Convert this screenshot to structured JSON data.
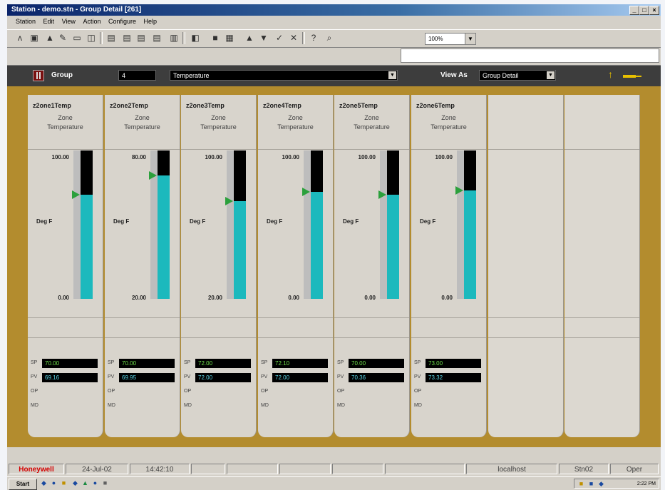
{
  "window": {
    "title": "Station - demo.stn - Group Detail [261]",
    "buttons": [
      "_",
      "□",
      "×"
    ]
  },
  "menu": [
    "Station",
    "Edit",
    "View",
    "Action",
    "Configure",
    "Help"
  ],
  "toolbar": {
    "icons": [
      "antenna-icon",
      "station-icon",
      "lock-icon",
      "pen-icon",
      "folder-icon",
      "display-icon",
      "page1-icon",
      "page2-icon",
      "page3-icon",
      "page4-icon",
      "print-icon",
      "chart-icon",
      "grid-icon",
      "trend-icon",
      "arrow-up-icon",
      "arrow-down-icon",
      "check-icon",
      "cancel-icon",
      "help-icon",
      "zoom-icon"
    ],
    "zoom": "100%"
  },
  "header": {
    "group_label": "Group",
    "group_number": "4",
    "group_name": "Temperature",
    "view_as_label": "View As",
    "view_as_value": "Group Detail"
  },
  "panels": [
    {
      "name": "z2one1Temp",
      "desc1": "Zone",
      "desc2": "Temperature",
      "max": "100.00",
      "min": "0.00",
      "units": "Deg F",
      "pv_fraction": 0.7,
      "sp_fraction": 0.7,
      "sp_label": "SP",
      "sp": "70.00",
      "pv_label": "PV",
      "pv": "69.16",
      "op_label": "OP",
      "md_label": "MD"
    },
    {
      "name": "z2one2Temp",
      "desc1": "Zone",
      "desc2": "Temperature",
      "max": "80.00",
      "min": "20.00",
      "units": "Deg F",
      "pv_fraction": 0.83,
      "sp_fraction": 0.83,
      "sp_label": "SP",
      "sp": "70.00",
      "pv_label": "PV",
      "pv": "69.95",
      "op_label": "OP",
      "md_label": "MD"
    },
    {
      "name": "z2one3Temp",
      "desc1": "Zone",
      "desc2": "Temperature",
      "max": "100.00",
      "min": "20.00",
      "units": "Deg F",
      "pv_fraction": 0.66,
      "sp_fraction": 0.66,
      "sp_label": "SP",
      "sp": "72.00",
      "pv_label": "PV",
      "pv": "72.00",
      "op_label": "OP",
      "md_label": "MD"
    },
    {
      "name": "z2one4Temp",
      "desc1": "Zone",
      "desc2": "Temperature",
      "max": "100.00",
      "min": "0.00",
      "units": "Deg F",
      "pv_fraction": 0.72,
      "sp_fraction": 0.72,
      "sp_label": "SP",
      "sp": "72.10",
      "pv_label": "PV",
      "pv": "72.00",
      "op_label": "OP",
      "md_label": "MD"
    },
    {
      "name": "z2one5Temp",
      "desc1": "Zone",
      "desc2": "Temperature",
      "max": "100.00",
      "min": "0.00",
      "units": "Deg F",
      "pv_fraction": 0.7,
      "sp_fraction": 0.7,
      "sp_label": "SP",
      "sp": "70.00",
      "pv_label": "PV",
      "pv": "70.36",
      "op_label": "OP",
      "md_label": "MD"
    },
    {
      "name": "z2one6Temp",
      "desc1": "Zone",
      "desc2": "Temperature",
      "max": "100.00",
      "min": "0.00",
      "units": "Deg F",
      "pv_fraction": 0.73,
      "sp_fraction": 0.73,
      "sp_label": "SP",
      "sp": "73.00",
      "pv_label": "PV",
      "pv": "73.32",
      "op_label": "OP",
      "md_label": "MD"
    }
  ],
  "status": {
    "brand": "Honeywell",
    "date": "24-Jul-02",
    "time": "14:42:10",
    "host": "localhost",
    "station": "Stn02",
    "mode": "Oper"
  },
  "taskbar": {
    "start": "Start",
    "clock": "2:22 PM"
  },
  "colors": {
    "frame": "#b38c2e",
    "header": "#3d3d3d",
    "pv_bar": "#1cb9bd",
    "sp_marker": "#2ba03c",
    "sp_text": "#6fe04a",
    "pv_text": "#5ad6e6",
    "brand": "#d40000"
  }
}
